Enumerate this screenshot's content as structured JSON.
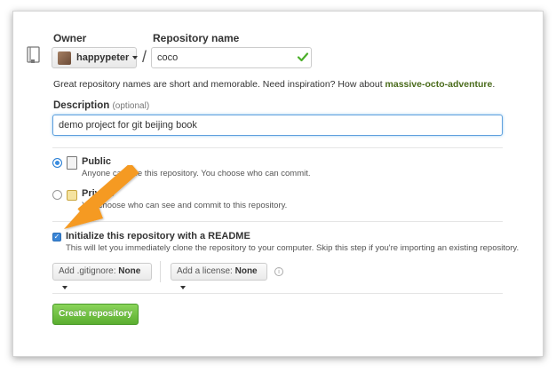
{
  "owner": {
    "label": "Owner",
    "name": "happypeter"
  },
  "repo": {
    "label": "Repository name",
    "value": "coco"
  },
  "hint": {
    "prefix": "Great repository names are short and memorable. Need inspiration? How about ",
    "suggestion": "massive-octo-adventure",
    "suffix": "."
  },
  "description": {
    "label": "Description",
    "optional": "(optional)",
    "value": "demo project for git beijing book"
  },
  "visibility": {
    "public": {
      "title": "Public",
      "desc": "Anyone can see this repository. You choose who can commit.",
      "selected": true
    },
    "private": {
      "title": "Private",
      "desc": "You choose who can see and commit to this repository.",
      "selected": false
    }
  },
  "readme": {
    "title": "Initialize this repository with a README",
    "desc": "This will let you immediately clone the repository to your computer. Skip this step if you're importing an existing repository.",
    "checked": true
  },
  "gitignore": {
    "prefix": "Add .gitignore:",
    "value": "None"
  },
  "license": {
    "prefix": "Add a license:",
    "value": "None"
  },
  "create_button": "Create repository",
  "colors": {
    "accent": "#3a8de0",
    "create": "#6cbd3e",
    "arrow": "#f59a23",
    "suggestion": "#4a6b1b"
  },
  "icons": [
    "repo-icon",
    "check-icon",
    "book-icon",
    "lock-icon",
    "info-icon",
    "caret-icon",
    "arrow-annotation"
  ]
}
